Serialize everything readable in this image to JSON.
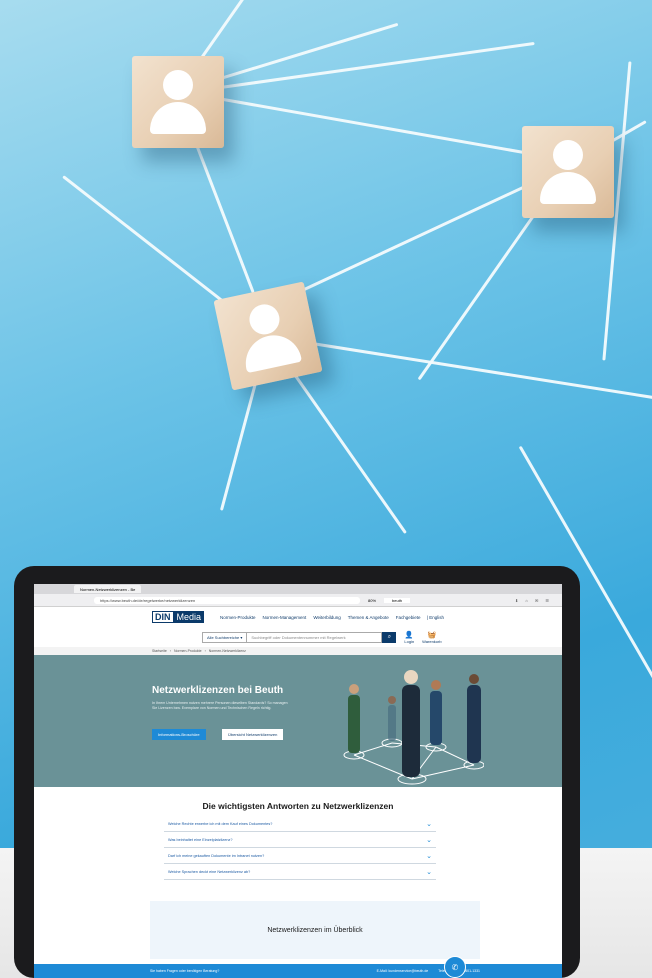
{
  "browser": {
    "tab_title": "Normen-Netzwerklizenzen - Be",
    "url": "https://www.beuth.de/de/regelwerke/netzwerklizenzen",
    "zoom": "80%",
    "search_placeholder": "beuth"
  },
  "site": {
    "logo_din": "DIN",
    "logo_media": "Media",
    "nav": [
      "Normen-Produkte",
      "Normen-Management",
      "Weiterbildung",
      "Themen & Angebote",
      "Fachgebiete"
    ],
    "language": "| English",
    "search_scope": "Alle Suchbereiche",
    "search_placeholder": "Suchbegriff oder Dokumentennummer mit Regelwerk",
    "login": "Login",
    "cart": "Warenkorb",
    "breadcrumb": [
      "Startseite",
      "Normen-Produkte",
      "Normen-Netzwerklizenz"
    ]
  },
  "hero": {
    "title": "Netzwerklizenzen bei Beuth",
    "text": "In Ihrem Unternehmen nutzen mehrere Personen dieselben Standards? So managen Sie Lizenzen bzw. Exemplare von Normen und Technischen Regeln richtig.",
    "button_primary": "Informations-Broschüre",
    "button_secondary": "Übersicht Netzwerklizenzen"
  },
  "faq": {
    "title": "Die wichtigsten Antworten zu Netzwerklizenzen",
    "items": [
      "Welche Rechte erwerbe ich mit dem Kauf eines Dokumentes?",
      "Was beinhaltet eine Einzelplatzlizenz?",
      "Darf ich meine gekauften Dokumente im Intranet nutzen?",
      "Welche Sprachen deckt eine Netzwerklizenz ab?"
    ]
  },
  "overview": {
    "title": "Netzwerklizenzen im Überblick"
  },
  "footer": {
    "question": "Sie haben Fragen oder benötigen Beratung?",
    "email": "E-Mail: kundenservice@beuth.de",
    "phone": "Telefon: +49 30 2601-1331"
  },
  "colors": {
    "sky": "#3aa9dc",
    "hero": "#6a9297",
    "accent": "#1e8ad6",
    "brand": "#0b3a6a"
  }
}
